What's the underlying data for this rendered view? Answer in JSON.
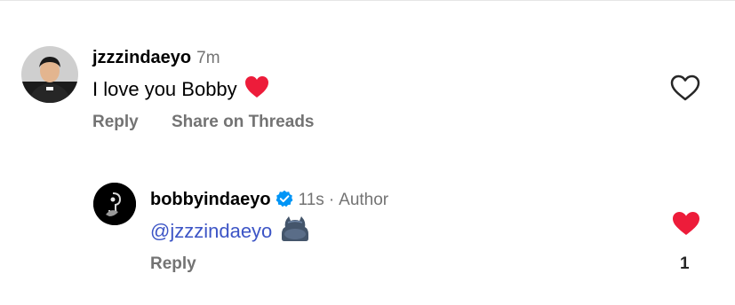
{
  "colors": {
    "meta_gray": "#737373",
    "mention_blue": "#3d55c6",
    "like_red": "#ed1c3a",
    "verified_blue": "#0095f6"
  },
  "comments": [
    {
      "username": "jzzzindaeyo",
      "time": "7m",
      "text": "I love you Bobby",
      "emoji": "red-heart",
      "reply_label": "Reply",
      "share_label": "Share on Threads",
      "liked": false,
      "like_icon": "heart-outline-icon"
    }
  ],
  "replies": [
    {
      "username": "bobbyindaeyo",
      "verified": true,
      "time": "11s",
      "separator": "·",
      "author_label": "Author",
      "mention": "@jzzzindaeyo",
      "emoji": "cat-silhouette",
      "reply_label": "Reply",
      "liked": true,
      "like_icon": "heart-filled-icon",
      "like_count": "1"
    }
  ]
}
